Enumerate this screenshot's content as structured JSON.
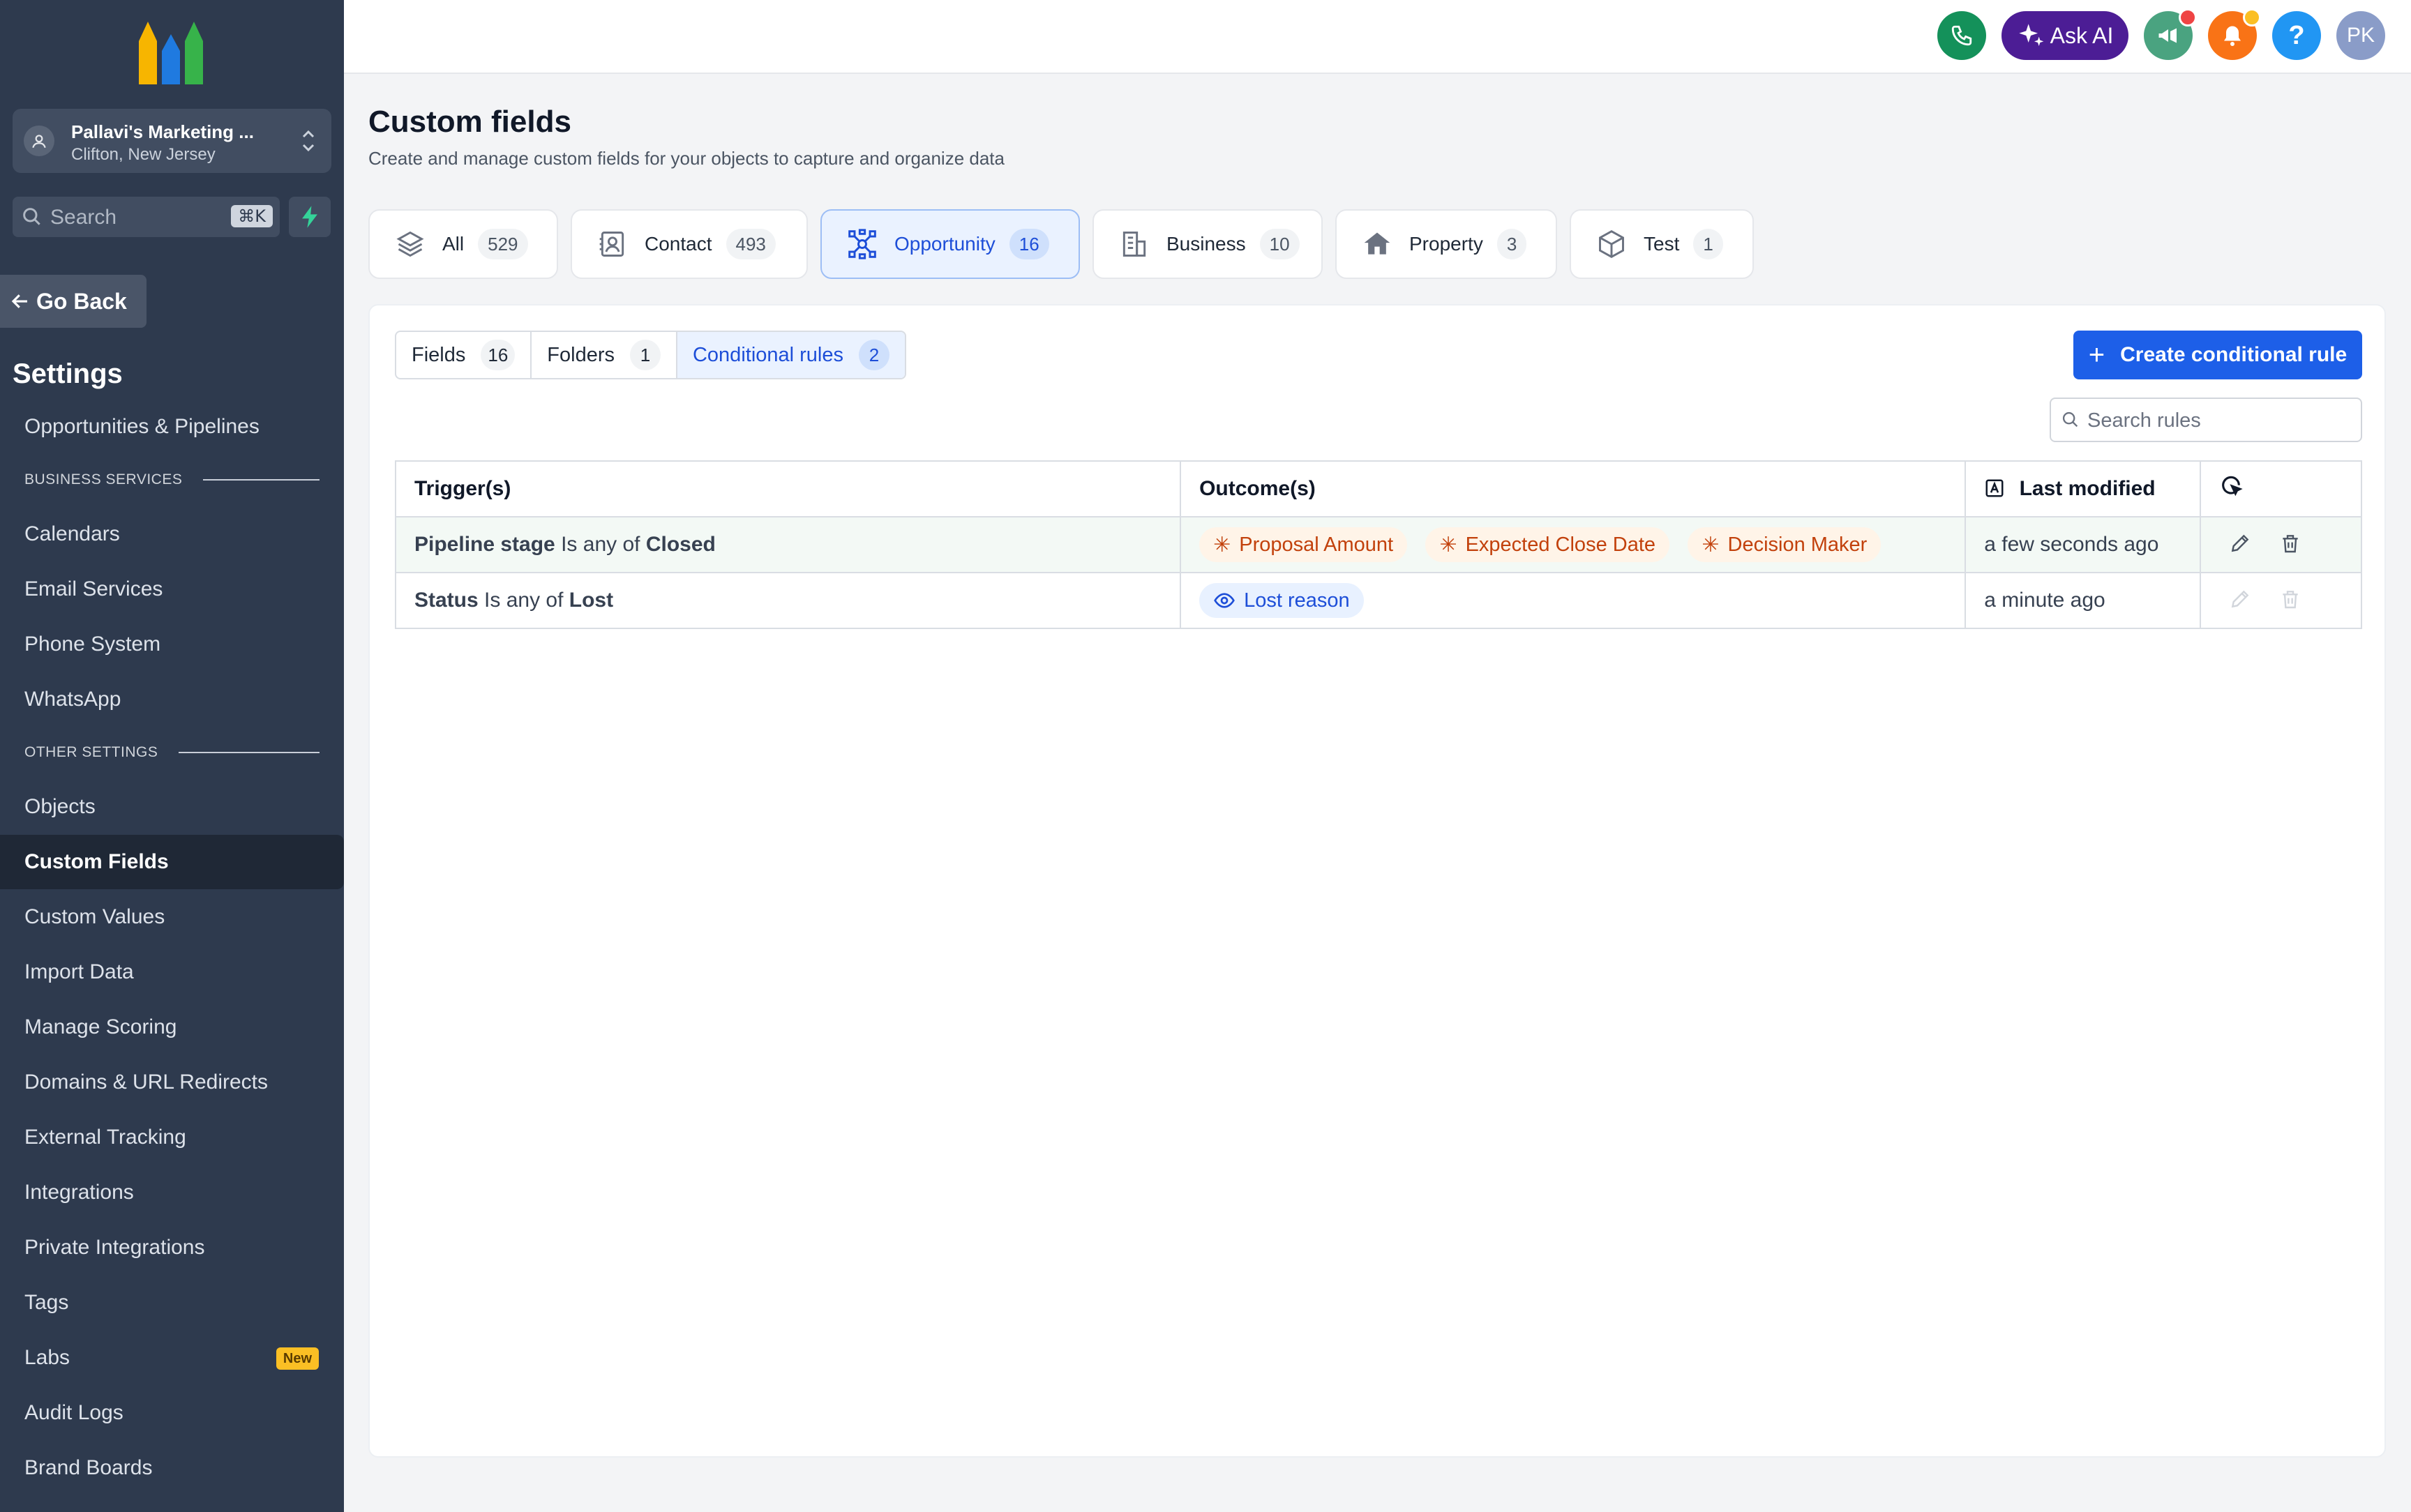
{
  "sidebar": {
    "account": {
      "name": "Pallavi's Marketing ...",
      "location": "Clifton, New Jersey"
    },
    "search": {
      "placeholder": "Search",
      "shortcut": "⌘K"
    },
    "go_back": "Go Back",
    "settings_title": "Settings",
    "top_item": "Opportunities & Pipelines",
    "section_business": "BUSINESS SERVICES",
    "business_items": [
      "Calendars",
      "Email Services",
      "Phone System",
      "WhatsApp"
    ],
    "section_other": "OTHER SETTINGS",
    "other_items": [
      "Objects",
      "Custom Fields",
      "Custom Values",
      "Import Data",
      "Manage Scoring",
      "Domains & URL Redirects",
      "External Tracking",
      "Integrations",
      "Private Integrations",
      "Tags",
      "Labs",
      "Audit Logs",
      "Brand Boards"
    ],
    "active_item": "Custom Fields",
    "labs_badge": "New"
  },
  "header": {
    "ask_ai": "Ask AI",
    "help": "?",
    "avatar": "PK"
  },
  "page": {
    "title": "Custom fields",
    "subtitle": "Create and manage custom fields for your objects to capture and organize data"
  },
  "object_tabs": [
    {
      "label": "All",
      "count": "529",
      "icon": "layers-icon"
    },
    {
      "label": "Contact",
      "count": "493",
      "icon": "contact-card-icon"
    },
    {
      "label": "Opportunity",
      "count": "16",
      "icon": "network-icon",
      "active": true
    },
    {
      "label": "Business",
      "count": "10",
      "icon": "building-icon"
    },
    {
      "label": "Property",
      "count": "3",
      "icon": "house-icon"
    },
    {
      "label": "Test",
      "count": "1",
      "icon": "cube-icon"
    }
  ],
  "sub_tabs": [
    {
      "label": "Fields",
      "count": "16"
    },
    {
      "label": "Folders",
      "count": "1"
    },
    {
      "label": "Conditional rules",
      "count": "2",
      "active": true
    }
  ],
  "create_button": "Create conditional rule",
  "search_rules_placeholder": "Search rules",
  "table": {
    "headers": {
      "trigger": "Trigger(s)",
      "outcome": "Outcome(s)",
      "last_modified": "Last modified"
    },
    "rows": [
      {
        "trigger_field": "Pipeline stage",
        "trigger_op": "Is any of",
        "trigger_value": "Closed",
        "outcomes": [
          "Proposal Amount",
          "Expected Close Date",
          "Decision Maker"
        ],
        "outcome_type": "required",
        "last_modified": "a few seconds ago"
      },
      {
        "trigger_field": "Status",
        "trigger_op": "Is any of",
        "trigger_value": "Lost",
        "outcomes": [
          "Lost reason"
        ],
        "outcome_type": "visible",
        "last_modified": "a minute ago"
      }
    ]
  },
  "colors": {
    "sidebar_bg": "#2e3a4e",
    "primary": "#1d5fe8",
    "required_chip": "#c2410c",
    "visible_chip": "#1d4ed8"
  }
}
